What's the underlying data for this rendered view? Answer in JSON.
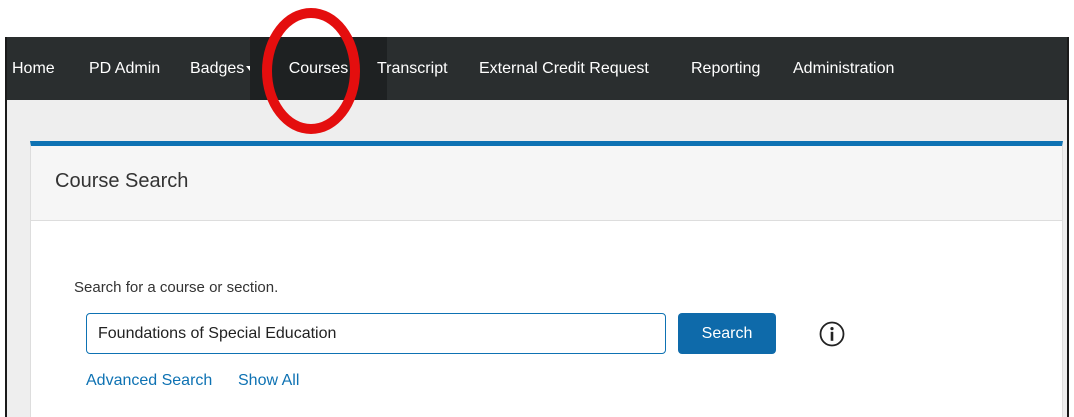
{
  "nav": {
    "items": [
      {
        "label": "Home"
      },
      {
        "label": "PD Admin"
      },
      {
        "label": "Badges"
      },
      {
        "label": "Courses"
      },
      {
        "label": "Transcript"
      },
      {
        "label": "External Credit Request"
      },
      {
        "label": "Reporting"
      },
      {
        "label": "Administration"
      }
    ],
    "active": "Courses"
  },
  "panel": {
    "title": "Course Search",
    "search_label": "Search for a course or section.",
    "search_value": "Foundations of Special Education",
    "search_button": "Search",
    "links": {
      "advanced": "Advanced Search",
      "show_all": "Show All"
    }
  },
  "colors": {
    "nav_bg": "#2a2e2f",
    "accent": "#0e72b3",
    "highlight": "#e40e0e"
  }
}
